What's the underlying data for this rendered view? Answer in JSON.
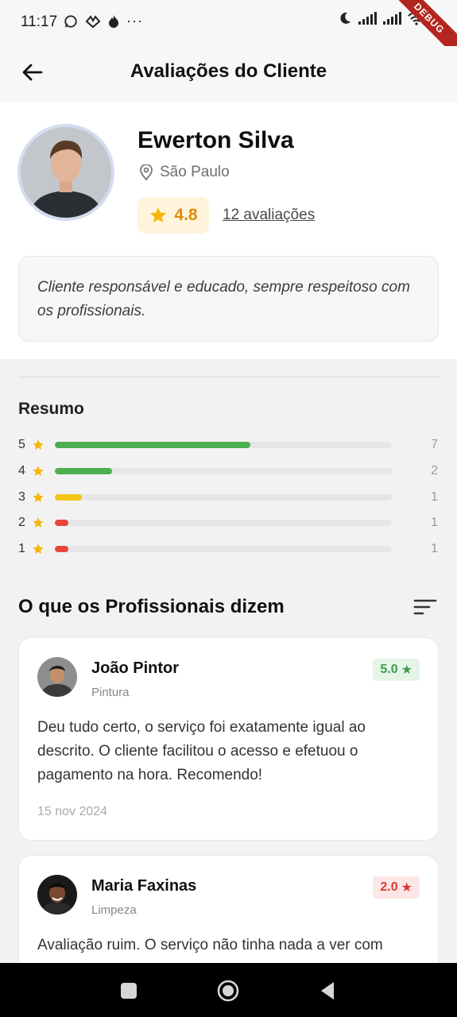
{
  "status": {
    "time": "11:17"
  },
  "appbar": {
    "title": "Avaliações do Cliente"
  },
  "client": {
    "name": "Ewerton Silva",
    "location": "São Paulo",
    "rating": "4.8",
    "reviews_link": "12 avaliações",
    "bio": "Cliente responsável e educado, sempre respeitoso com os profissionais."
  },
  "summary": {
    "title": "Resumo",
    "rows": [
      {
        "stars": "5",
        "count": "7",
        "fraction": 0.58,
        "color": "#4caf50"
      },
      {
        "stars": "4",
        "count": "2",
        "fraction": 0.17,
        "color": "#4caf50"
      },
      {
        "stars": "3",
        "count": "1",
        "fraction": 0.08,
        "color": "#f5c518"
      },
      {
        "stars": "2",
        "count": "1",
        "fraction": 0.04,
        "color": "#e8443a"
      },
      {
        "stars": "1",
        "count": "1",
        "fraction": 0.04,
        "color": "#e8443a"
      }
    ]
  },
  "section": {
    "title": "O que os Profissionais dizem"
  },
  "reviews": [
    {
      "name": "João Pintor",
      "category": "Pintura",
      "score": "5.0",
      "score_color": "#3a9d4a",
      "score_bg": "#e6f4e8",
      "text": "Deu tudo certo, o serviço foi exatamente igual ao descrito. O cliente facilitou o acesso e efetuou o pagamento na hora. Recomendo!",
      "date": "15 nov 2024"
    },
    {
      "name": "Maria Faxinas",
      "category": "Limpeza",
      "score": "2.0",
      "score_color": "#d93a33",
      "score_bg": "#fde7e6",
      "text": "Avaliação ruim. O serviço não tinha nada a ver com",
      "date": ""
    }
  ],
  "colors": {
    "star": "#f5b50a",
    "accent": "#e08a00"
  }
}
